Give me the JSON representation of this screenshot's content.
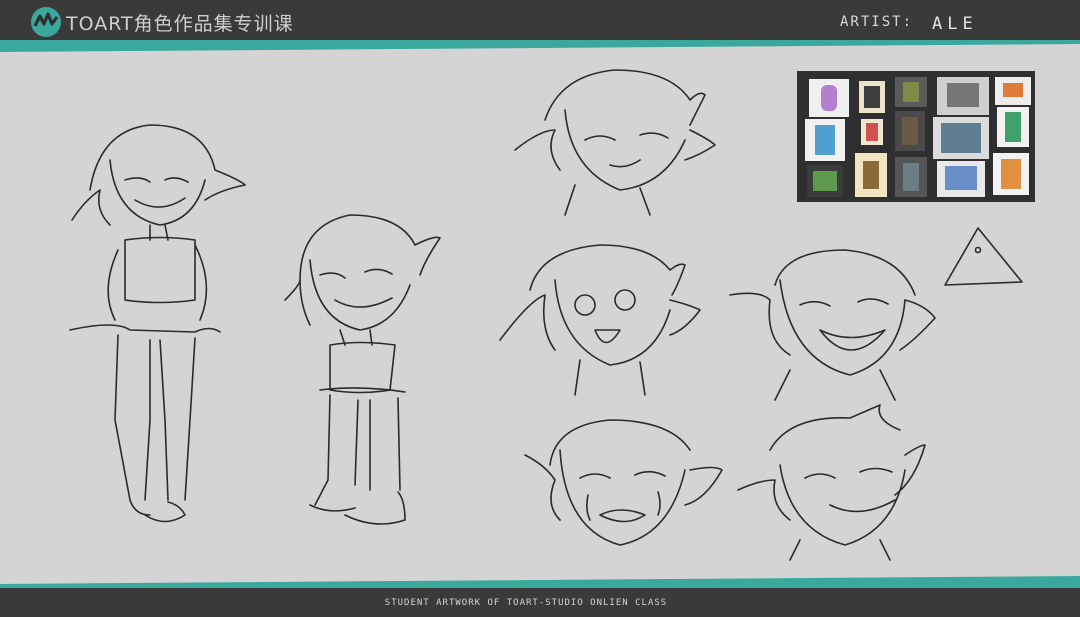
{
  "header": {
    "brand_text": "TOART角色作品集专训课",
    "artist_label": "ARTIST:",
    "artist_name": "ALE"
  },
  "footer": {
    "caption": "STUDENT ARTWORK OF TOART-STUDIO ONLIEN CLASS"
  },
  "colors": {
    "bar": "#3a3a3a",
    "accent": "#3aa89c",
    "background": "#d4d4d4",
    "pencil": "#2b2b2b"
  },
  "icons": {
    "logo": "toart-logo-icon"
  }
}
